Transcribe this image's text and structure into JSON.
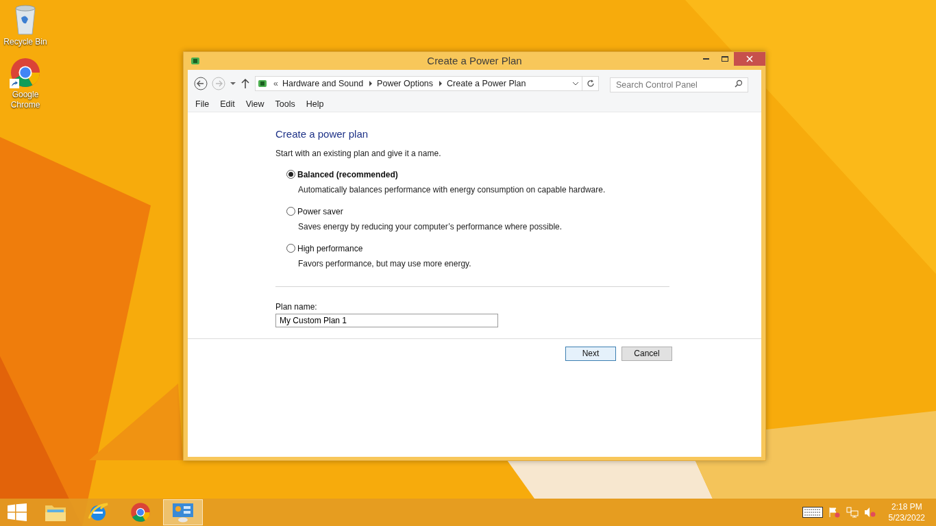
{
  "desktop_icons": [
    {
      "kind": "bin",
      "label": "Recycle Bin"
    },
    {
      "kind": "chrome",
      "label": "Google Chrome"
    }
  ],
  "window": {
    "title": "Create a Power Plan",
    "address": {
      "overflow": "«",
      "crumbs": [
        "Hardware and Sound",
        "Power Options",
        "Create a Power Plan"
      ]
    },
    "search": {
      "placeholder": "Search Control Panel"
    },
    "menu": [
      "File",
      "Edit",
      "View",
      "Tools",
      "Help"
    ],
    "heading": "Create a power plan",
    "intro": "Start with an existing plan and give it a name.",
    "plans": [
      {
        "name": "Balanced (recommended)",
        "description": "Automatically balances performance with energy consumption on capable hardware.",
        "selected": true
      },
      {
        "name": "Power saver",
        "description": "Saves energy by reducing your computer’s performance where possible.",
        "selected": false
      },
      {
        "name": "High performance",
        "description": "Favors performance, but may use more energy.",
        "selected": false
      }
    ],
    "plan_name": {
      "label": "Plan name:",
      "value": "My Custom Plan 1"
    },
    "buttons": [
      {
        "label": "Next",
        "default": true
      },
      {
        "label": "Cancel",
        "default": false
      }
    ]
  },
  "taskbar": {
    "apps": [
      {
        "kind": "explorer",
        "selected": false
      },
      {
        "kind": "ie",
        "selected": false
      },
      {
        "kind": "chrome",
        "selected": false
      },
      {
        "kind": "control",
        "selected": true
      }
    ],
    "time": "2:18 PM",
    "date": "5/23/2022"
  }
}
